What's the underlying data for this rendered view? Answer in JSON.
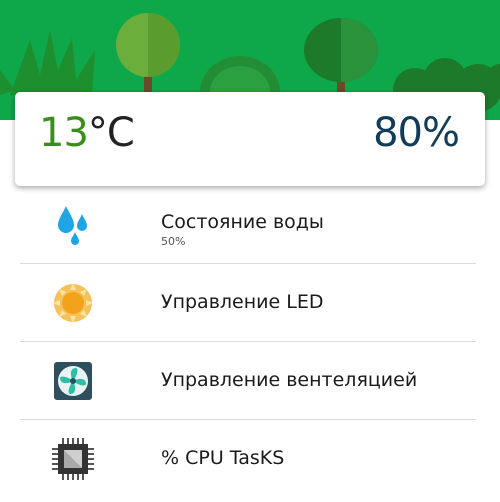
{
  "header": {
    "temperature_value": "13",
    "temperature_unit": "°C",
    "humidity": "80%"
  },
  "menu": {
    "items": [
      {
        "label": "Состояние воды",
        "sublabel": "50%",
        "icon": "water-drops-icon"
      },
      {
        "label": "Управление LED",
        "icon": "sun-icon"
      },
      {
        "label": "Управление вентеляцией",
        "icon": "fan-icon"
      },
      {
        "label": "% CPU TasKS",
        "icon": "cpu-chip-icon"
      }
    ]
  },
  "colors": {
    "banner": "#0ea84a",
    "temperature": "#3a8f1b",
    "humidity": "#123c57",
    "divider": "#dcdcdc"
  }
}
